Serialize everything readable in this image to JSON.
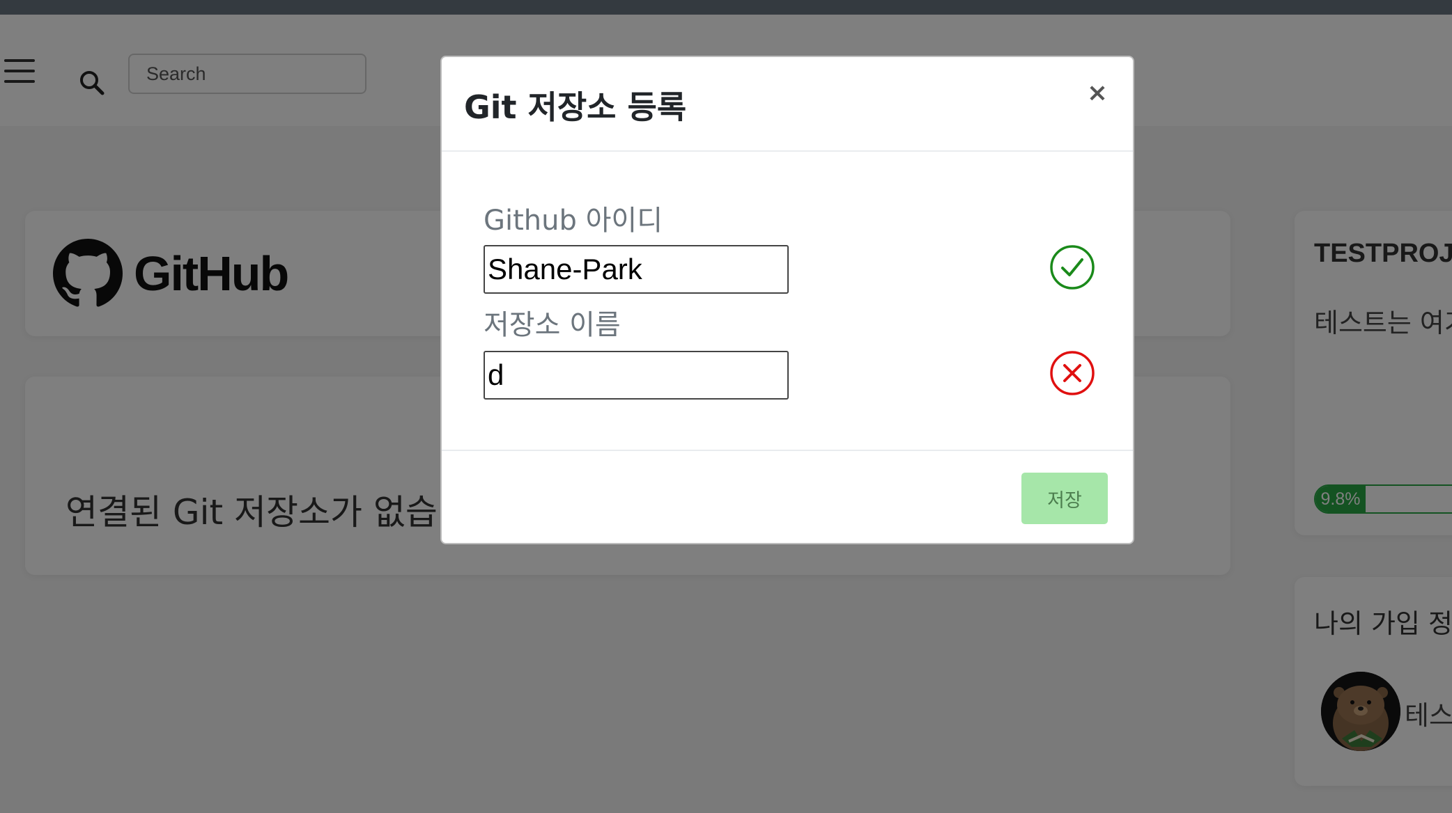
{
  "navbar": {
    "search_placeholder": "Search"
  },
  "github_card": {
    "logo_text": "GitHub"
  },
  "no_repo_card": {
    "message": "연결된 Git 저장소가 없습니다"
  },
  "project_card": {
    "title": "TESTPROJECT",
    "description": "테스트는 여기에",
    "progress": {
      "percent": 9.8,
      "label": "9.8%",
      "color": "#28a745"
    }
  },
  "member_card": {
    "title": "나의 가입 정보",
    "name": "테스트"
  },
  "modal": {
    "title": "Git 저장소 등록",
    "close_label": "×",
    "github_id": {
      "label": "Github 아이디",
      "value": "Shane-Park",
      "status": "valid",
      "status_color": "#1a8a1a"
    },
    "repo_name": {
      "label": "저장소 이름",
      "value": "d",
      "status": "invalid",
      "status_color": "#e01010"
    },
    "save_label": "저장",
    "save_color": "#a6e6a9"
  }
}
